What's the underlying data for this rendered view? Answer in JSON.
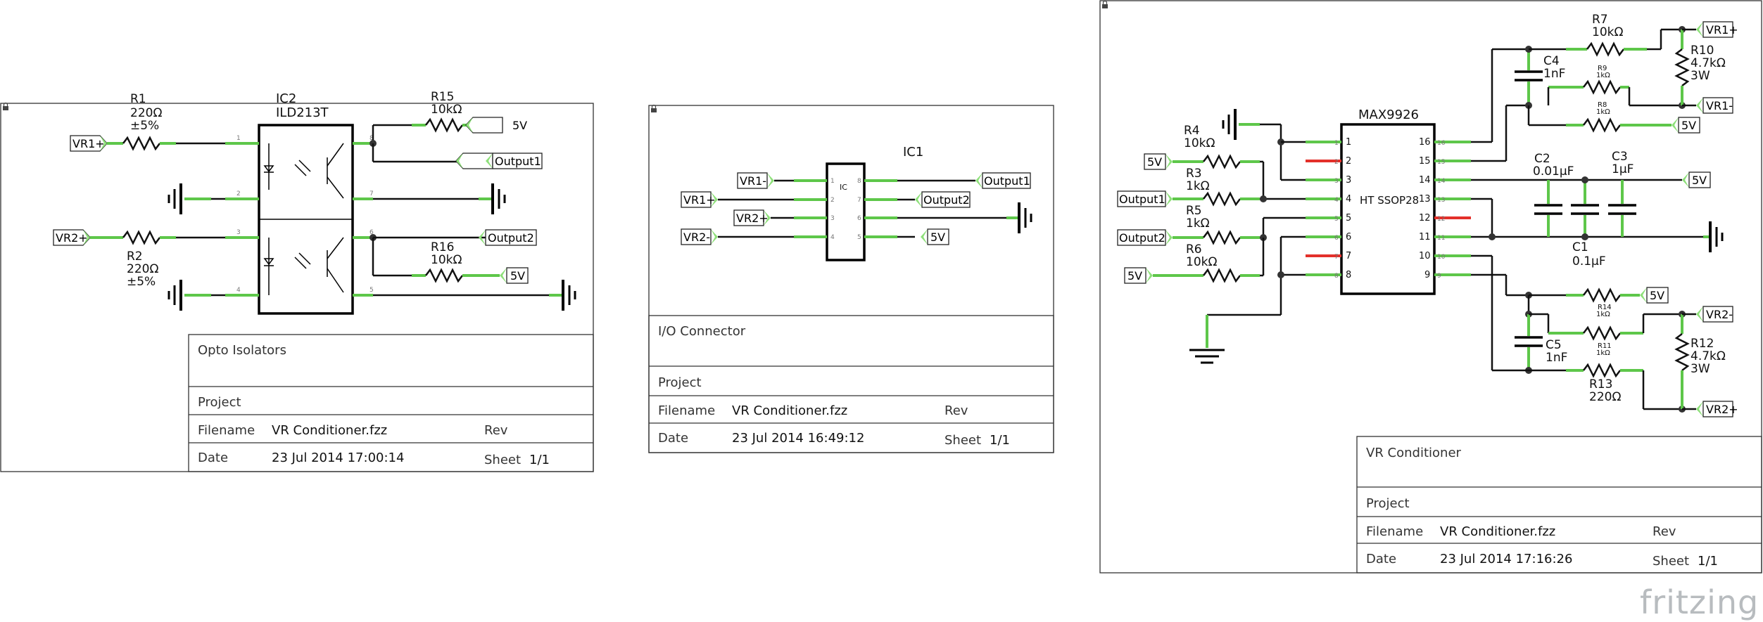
{
  "app": {
    "logo_text": "fritzing"
  },
  "sheets": {
    "opto": {
      "title": "Opto Isolators",
      "project_label": "Project",
      "filename_label": "Filename",
      "filename": "VR Conditioner.fzz",
      "rev_label": "Rev",
      "date_label": "Date",
      "date": "23 Jul 2014 17:00:14",
      "sheet_label": "Sheet",
      "sheet_value": "1/1",
      "ic_ref": "IC2",
      "ic_part": "ILD213T",
      "r1": {
        "ref": "R1",
        "value": "220Ω",
        "tol": "±5%"
      },
      "r2": {
        "ref": "R2",
        "value": "220Ω",
        "tol": "±5%"
      },
      "r15": {
        "ref": "R15",
        "value": "10kΩ"
      },
      "r16": {
        "ref": "R16",
        "value": "10kΩ"
      },
      "nets": {
        "vr1p": "VR1+",
        "vr2p": "VR2+",
        "v5a": "5V",
        "v5b": "5V",
        "out1": "Output1",
        "out2": "Output2"
      }
    },
    "io": {
      "title": "I/O Connector",
      "project_label": "Project",
      "filename_label": "Filename",
      "filename": "VR Conditioner.fzz",
      "rev_label": "Rev",
      "date_label": "Date",
      "date": "23 Jul 2014 16:49:12",
      "sheet_label": "Sheet",
      "sheet_value": "1/1",
      "ic_ref": "IC1",
      "ic_body": "IC",
      "nets": {
        "vr1m": "VR1-",
        "vr1p": "VR1+",
        "vr2p": "VR2+",
        "vr2m": "VR2-",
        "out1": "Output1",
        "out2": "Output2",
        "v5": "5V"
      }
    },
    "vr": {
      "title": "VR Conditioner",
      "project_label": "Project",
      "filename_label": "Filename",
      "filename": "VR Conditioner.fzz",
      "rev_label": "Rev",
      "date_label": "Date",
      "date": "23 Jul 2014 17:16:26",
      "sheet_label": "Sheet",
      "sheet_value": "1/1",
      "ic_part": "MAX9926",
      "ic_body": "HT SSOP28",
      "r3": {
        "ref": "R3",
        "value": "1kΩ"
      },
      "r4": {
        "ref": "R4",
        "value": "10kΩ"
      },
      "r5": {
        "ref": "R5",
        "value": "1kΩ"
      },
      "r6": {
        "ref": "R6",
        "value": "10kΩ"
      },
      "r7": {
        "ref": "R7",
        "value": "10kΩ"
      },
      "r8": {
        "ref": "R8",
        "value": "1kΩ"
      },
      "r9": {
        "ref": "R9",
        "value": "1kΩ"
      },
      "r10": {
        "ref": "R10",
        "value": "4.7kΩ",
        "power": "3W"
      },
      "r11": {
        "ref": "R11",
        "value": "1kΩ"
      },
      "r12": {
        "ref": "R12",
        "value": "4.7kΩ",
        "power": "3W"
      },
      "r13": {
        "ref": "R13",
        "value": "220Ω"
      },
      "r14": {
        "ref": "R14",
        "value": "1kΩ"
      },
      "c1": {
        "ref": "C1",
        "value": "0.1µF"
      },
      "c2": {
        "ref": "C2",
        "value": "0.01µF"
      },
      "c3": {
        "ref": "C3",
        "value": "1µF"
      },
      "c4": {
        "ref": "C4",
        "value": "1nF"
      },
      "c5": {
        "ref": "C5",
        "value": "1nF"
      },
      "nets": {
        "v5a": "5V",
        "v5b": "5V",
        "v5c": "5V",
        "v5d": "5V",
        "v5e": "5V",
        "out1": "Output1",
        "out2": "Output2",
        "vr1p": "VR1+",
        "vr1m": "VR1-",
        "vr2p": "VR2+",
        "vr2m": "VR2-"
      }
    }
  }
}
